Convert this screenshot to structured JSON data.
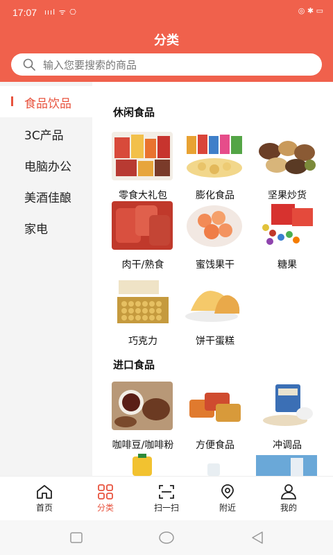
{
  "status_bar": {
    "time": "17:07",
    "signal": "ıııl ᯤ ⎔",
    "right": "◎ ✱ ▭"
  },
  "header": {
    "title": "分类",
    "search_placeholder": "输入您要搜索的商品"
  },
  "sidebar": {
    "items": [
      {
        "label": "食品饮品",
        "active": true
      },
      {
        "label": "3C产品"
      },
      {
        "label": "电脑办公"
      },
      {
        "label": "美酒佳酿"
      },
      {
        "label": "家电"
      }
    ]
  },
  "sections": [
    {
      "title": "休闲食品",
      "items": [
        {
          "label": "零食大礼包",
          "icon": "snack-gift-pack-image"
        },
        {
          "label": "膨化食品",
          "icon": "puffed-food-image"
        },
        {
          "label": "坚果炒货",
          "icon": "nuts-image"
        },
        {
          "label": "肉干/熟食",
          "icon": "jerky-image"
        },
        {
          "label": "蜜饯果干",
          "icon": "dried-fruit-image"
        },
        {
          "label": "糖果",
          "icon": "candy-image"
        },
        {
          "label": "巧克力",
          "icon": "chocolate-image"
        },
        {
          "label": "饼干蛋糕",
          "icon": "cake-image"
        }
      ]
    },
    {
      "title": "进口食品",
      "items": [
        {
          "label": "咖啡豆/咖啡粉",
          "icon": "coffee-image"
        },
        {
          "label": "方便食品",
          "icon": "instant-food-image"
        },
        {
          "label": "冲调品",
          "icon": "oatmeal-image"
        }
      ]
    }
  ],
  "tabbar": {
    "items": [
      {
        "label": "首页",
        "icon": "home-icon"
      },
      {
        "label": "分类",
        "icon": "category-icon",
        "active": true
      },
      {
        "label": "扫一扫",
        "icon": "scan-icon"
      },
      {
        "label": "附近",
        "icon": "location-icon"
      },
      {
        "label": "我的",
        "icon": "user-icon"
      }
    ]
  },
  "colors": {
    "accent": "#f0614c",
    "active_text": "#e8533e"
  }
}
